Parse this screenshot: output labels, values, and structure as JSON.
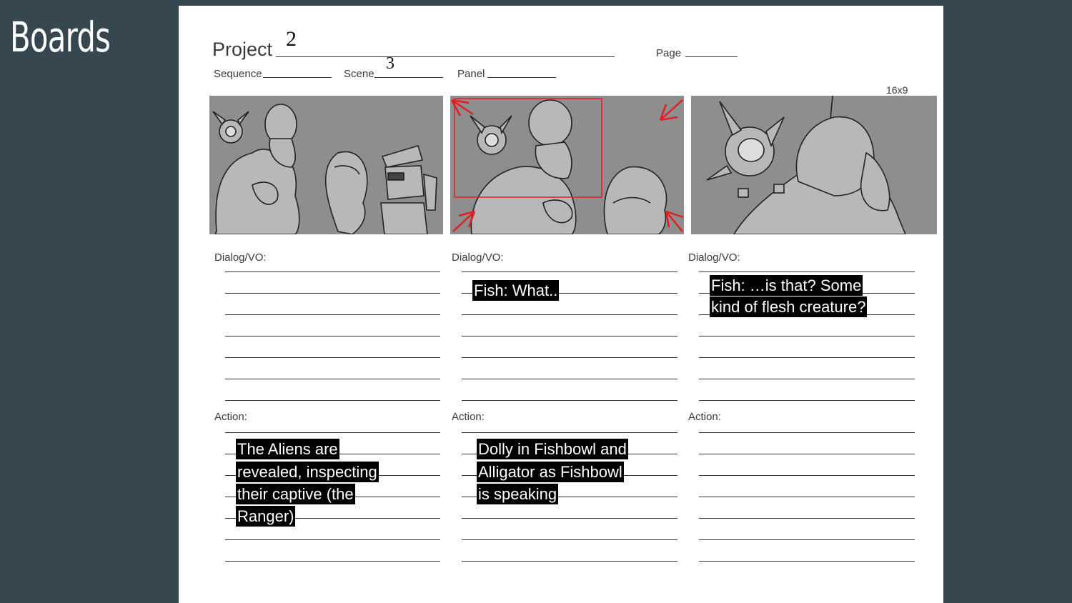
{
  "slide": {
    "title": "Boards"
  },
  "form": {
    "project_label": "Project",
    "project_value": "2",
    "page_label": "Page",
    "sequence_label": "Sequence",
    "scene_label": "Scene",
    "scene_value": "3",
    "panel_label": "Panel",
    "aspect_label": "16x9"
  },
  "columns": [
    {
      "dialog_label": "Dialog/VO:",
      "dialog_lines": [],
      "action_label": "Action:",
      "action_lines": [
        "The Aliens are",
        "revealed, inspecting",
        "their captive (the",
        "Ranger)"
      ]
    },
    {
      "dialog_label": "Dialog/VO:",
      "dialog_lines": [
        "Fish: What.."
      ],
      "action_label": "Action:",
      "action_lines": [
        "Dolly in Fishbowl and",
        "Alligator as Fishbowl",
        "is speaking"
      ]
    },
    {
      "dialog_label": "Dialog/VO:",
      "dialog_lines": [
        "Fish: …is that? Some",
        "kind of flesh creature?"
      ],
      "action_label": "Action:",
      "action_lines": []
    }
  ],
  "colors": {
    "background": "#37474f",
    "sheet": "#ffffff",
    "frame_gray": "#8e8e8e",
    "markup_red": "#e02020"
  }
}
